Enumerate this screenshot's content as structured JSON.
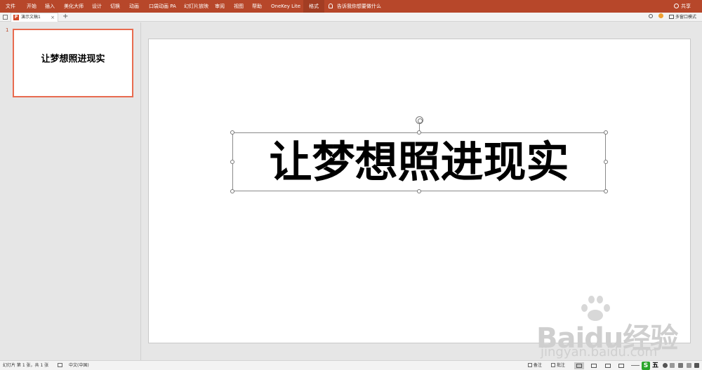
{
  "ribbon": {
    "tabs": [
      "文件",
      "开始",
      "插入",
      "美化大师",
      "设计",
      "切换",
      "动画",
      "口袋动画 PA",
      "幻灯片放映",
      "审阅",
      "视图",
      "帮助",
      "OneKey Lite",
      "格式"
    ],
    "active_tab": "格式",
    "tell_me": "告诉我你想要做什么",
    "share": "共享"
  },
  "docbar": {
    "doc_name": "演示文稿1",
    "app_icon": "P",
    "close": "×",
    "new_tab": "+",
    "multi_window": "多窗口模式"
  },
  "thumbnails": [
    {
      "number": "1",
      "title": "让梦想照进现实"
    }
  ],
  "slide": {
    "title": "让梦想照进现实"
  },
  "watermark": {
    "brand": "Baidu经验",
    "url": "jingyan.baidu.com"
  },
  "status": {
    "slide_info": "幻灯片 第 1 张，共 1 张",
    "language": "中文(中国)",
    "notes": "备注",
    "comments": "批注",
    "ime_lang": "五"
  },
  "colors": {
    "ribbon": "#b7472a",
    "thumb_border": "#e86b4f"
  }
}
